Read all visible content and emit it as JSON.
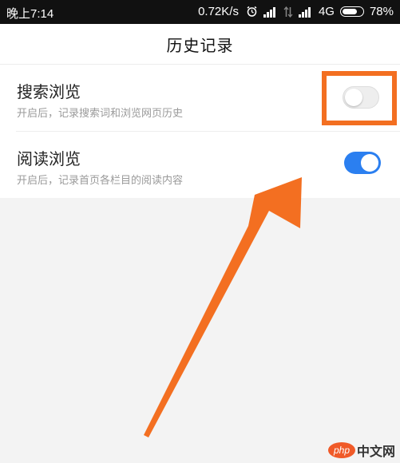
{
  "status_bar": {
    "time": "晚上7:14",
    "net_speed": "0.72K/s",
    "network_type": "4G",
    "battery_text": "78%",
    "battery_level": 0.78,
    "icons": [
      "alarm-icon",
      "signal-icon",
      "data-arrows-icon",
      "signal-icon",
      "battery-icon"
    ]
  },
  "header": {
    "title": "历史记录"
  },
  "settings": [
    {
      "title": "搜索浏览",
      "description": "开启后，记录搜索词和浏览网页历史",
      "enabled": false
    },
    {
      "title": "阅读浏览",
      "description": "开启后，记录首页各栏目的阅读内容",
      "enabled": true
    }
  ],
  "annotation": {
    "highlight_color": "#f36f21",
    "arrow_color": "#f36f21"
  },
  "watermark": {
    "logo_text": "php",
    "text": "中文网"
  },
  "colors": {
    "toggle_on": "#2b7ff0",
    "toggle_off": "#eeeeee",
    "status_bar_bg": "#111111",
    "page_bg": "#f3f3f3"
  }
}
